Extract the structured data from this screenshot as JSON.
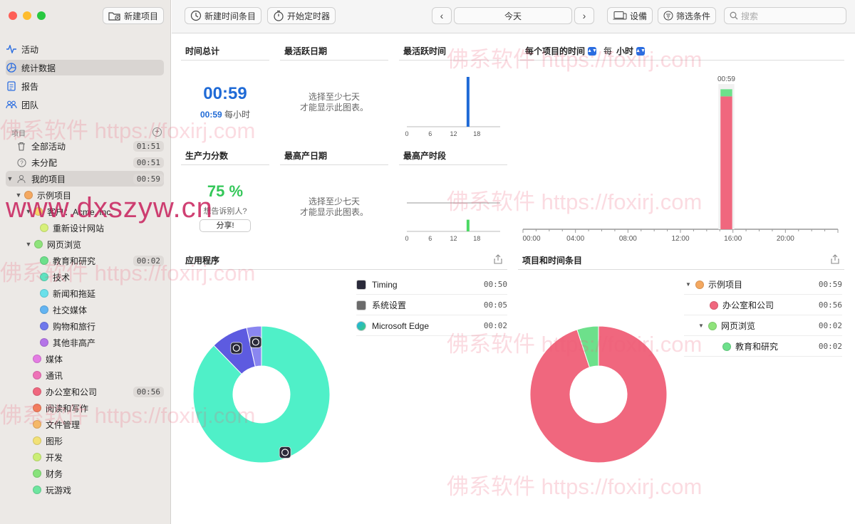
{
  "window": {
    "traffic_lights": [
      "#fe5f57",
      "#febc2e",
      "#28c840"
    ]
  },
  "toolbar": {
    "new_project": "新建项目",
    "new_time_entry": "新建时间条目",
    "start_timer": "开始定时器",
    "date_label": "今天",
    "device": "设備",
    "filter": "筛选条件",
    "search_placeholder": "搜索"
  },
  "sidebar": {
    "nav": [
      {
        "label": "活动",
        "icon": "activity-icon"
      },
      {
        "label": "统计数据",
        "icon": "stats-icon",
        "selected": true
      },
      {
        "label": "报告",
        "icon": "report-icon"
      },
      {
        "label": "团队",
        "icon": "team-icon"
      }
    ],
    "projects_header": "项目",
    "all_activities": {
      "label": "全部活动",
      "time": "01:51"
    },
    "unassigned": {
      "label": "未分配",
      "time": "00:51"
    },
    "my_projects": {
      "label": "我的项目",
      "time": "00:59"
    },
    "tree": [
      {
        "label": "示例项目",
        "color": "#f4a860",
        "level": 1,
        "chevron": true
      },
      {
        "label": "客户：Acme, Inc.",
        "color": "#f6d66a",
        "level": 2,
        "chevron": true
      },
      {
        "label": "重新设计网站",
        "color": "#d7f07a",
        "level": 3
      },
      {
        "label": "网页浏览",
        "color": "#8fe37b",
        "level": 2,
        "chevron": true
      },
      {
        "label": "教育和研究",
        "color": "#6de08b",
        "level": 3,
        "time": "00:02"
      },
      {
        "label": "技术",
        "color": "#5fe3c0",
        "level": 3
      },
      {
        "label": "新闻和拖延",
        "color": "#69e0ea",
        "level": 3
      },
      {
        "label": "社交媒体",
        "color": "#63b4f2",
        "level": 3
      },
      {
        "label": "购物和旅行",
        "color": "#6f78ec",
        "level": 3
      },
      {
        "label": "其他非高产",
        "color": "#b474e8",
        "level": 3
      },
      {
        "label": "媒体",
        "color": "#e47ce3",
        "level": 2
      },
      {
        "label": "通讯",
        "color": "#ee72b8",
        "level": 2
      },
      {
        "label": "办公室和公司",
        "color": "#f0677e",
        "level": 2,
        "time": "00:56"
      },
      {
        "label": "阅读和写作",
        "color": "#f27f5c",
        "level": 2
      },
      {
        "label": "文件管理",
        "color": "#f5b868",
        "level": 2
      },
      {
        "label": "图形",
        "color": "#f2e176",
        "level": 2
      },
      {
        "label": "开发",
        "color": "#cbee75",
        "level": 2
      },
      {
        "label": "财务",
        "color": "#88e27b",
        "level": 2
      },
      {
        "label": "玩游戏",
        "color": "#6ee59f",
        "level": 2
      }
    ]
  },
  "stats": {
    "total_time_title": "时间总计",
    "total_time": "00:59",
    "per_hour_value": "00:59",
    "per_hour_label": "每小时",
    "most_active_day_title": "最活跃日期",
    "need_seven_days": "选择至少七天\n才能显示此图表。",
    "most_active_time_title": "最活跃时间",
    "productivity_title": "生产力分数",
    "productivity_value": "75 %",
    "tell_others": "想告诉别人?",
    "share": "分享!",
    "most_productive_day_title": "最高产日期",
    "most_productive_period_title": "最高产时段",
    "small_axis_ticks": [
      "0",
      "6",
      "12",
      "18"
    ],
    "per_project_title_pre": "每个项目的时间",
    "per_label": "每",
    "hour_label": "小时",
    "big_axis_ticks": [
      "00:00",
      "04:00",
      "08:00",
      "12:00",
      "16:00",
      "20:00"
    ],
    "bar_peak_label": "00:59"
  },
  "apps": {
    "title": "应用程序",
    "items": [
      {
        "name": "Timing",
        "time": "00:50",
        "color": "#4ff0c8",
        "icon": "timing-app-icon"
      },
      {
        "name": "系统设置",
        "time": "00:05",
        "color": "#5d5be0",
        "icon": "settings-app-icon"
      },
      {
        "name": "Microsoft Edge",
        "time": "00:02",
        "color": "#8a86f0",
        "icon": "edge-app-icon"
      }
    ]
  },
  "projects_entries": {
    "title": "项目和时间条目",
    "items": [
      {
        "name": "示例项目",
        "time": "00:59",
        "color": "#f4a860",
        "level": 0,
        "chevron": true
      },
      {
        "name": "办公室和公司",
        "time": "00:56",
        "color": "#f0677e",
        "level": 1
      },
      {
        "name": "网页浏览",
        "time": "00:02",
        "color": "#8fe37b",
        "level": 1,
        "chevron": true
      },
      {
        "name": "教育和研究",
        "time": "00:02",
        "color": "#6de08b",
        "level": 2
      }
    ]
  },
  "chart_data": [
    {
      "type": "bar",
      "title": "最活跃时间",
      "x": [
        0,
        6,
        12,
        18
      ],
      "bars": [
        {
          "hour": 15,
          "value_minutes": 59,
          "color": "#1f6ad6"
        }
      ],
      "xlim": [
        0,
        24
      ]
    },
    {
      "type": "bar",
      "title": "最高产时段",
      "x": [
        0,
        6,
        12,
        18
      ],
      "bars": [
        {
          "hour": 15,
          "productivity": 0.75,
          "color": "#4cd964"
        }
      ],
      "xlim": [
        0,
        24
      ]
    },
    {
      "type": "bar",
      "title": "每个项目的时间 每 小时",
      "categories": [
        "00:00",
        "04:00",
        "08:00",
        "12:00",
        "16:00",
        "20:00"
      ],
      "series": [
        {
          "name": "办公室和公司",
          "hour": 15,
          "minutes": 56,
          "color": "#f0677e"
        },
        {
          "name": "网页浏览",
          "hour": 15,
          "minutes": 3,
          "color": "#6de08b"
        }
      ],
      "data_label": "00:59",
      "ylim": [
        0,
        60
      ]
    },
    {
      "type": "pie",
      "title": "应用程序",
      "slices": [
        {
          "label": "Timing",
          "minutes": 50,
          "color": "#4ff0c8"
        },
        {
          "label": "系统设置",
          "minutes": 5,
          "color": "#5d5be0"
        },
        {
          "label": "Microsoft Edge",
          "minutes": 2,
          "color": "#8a86f0"
        }
      ]
    },
    {
      "type": "pie",
      "title": "项目和时间条目",
      "slices": [
        {
          "label": "办公室和公司",
          "minutes": 56,
          "color": "#f0677e"
        },
        {
          "label": "教育和研究",
          "minutes": 3,
          "color": "#6de08b"
        }
      ]
    }
  ],
  "watermarks": {
    "foxirj": "佛系软件 https://foxirj.com",
    "dxszyw": "www.dxszyw.cn"
  }
}
